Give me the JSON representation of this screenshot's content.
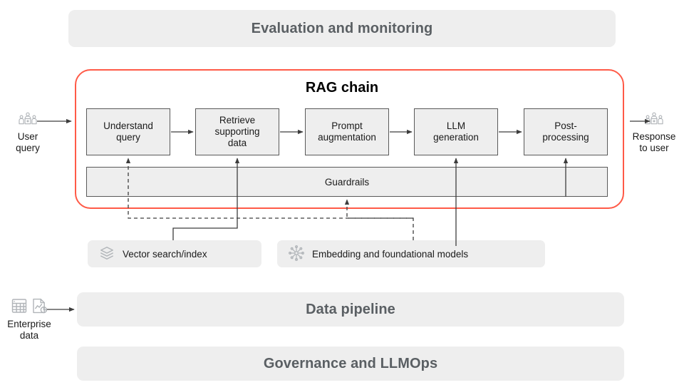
{
  "banners": [
    {
      "id": "evaluation",
      "label": "Evaluation and monitoring"
    },
    {
      "id": "data-pipeline",
      "label": "Data pipeline"
    },
    {
      "id": "governance",
      "label": "Governance and LLMOps"
    }
  ],
  "rag_chain": {
    "title": "RAG chain",
    "border_color": "#ff5a47",
    "steps": [
      {
        "id": "understand-query",
        "label": "Understand\nquery"
      },
      {
        "id": "retrieve-data",
        "label": "Retrieve\nsupporting\ndata"
      },
      {
        "id": "prompt-augmentation",
        "label": "Prompt\naugmentation"
      },
      {
        "id": "llm-generation",
        "label": "LLM\ngeneration"
      },
      {
        "id": "post-processing",
        "label": "Post-\nprocessing"
      }
    ],
    "guardrails": {
      "label": "Guardrails"
    }
  },
  "resources": [
    {
      "id": "vector-search",
      "label": "Vector search/index",
      "icon": "layers-stack-icon"
    },
    {
      "id": "embedding-models",
      "label": "Embedding and foundational models",
      "icon": "snowflake-network-icon"
    }
  ],
  "endpoints": [
    {
      "id": "user-query",
      "label": "User\nquery",
      "icons": [
        "user-group-icon"
      ]
    },
    {
      "id": "response-to-user",
      "label": "Response\nto user",
      "icons": [
        "user-group-icon"
      ]
    },
    {
      "id": "enterprise-data",
      "label": "Enterprise\ndata",
      "icons": [
        "table-grid-icon",
        "document-chart-icon"
      ]
    }
  ],
  "colors": {
    "accent": "#ff5a47",
    "banner_fill": "#eeeeee",
    "banner_text": "#5a5f63",
    "box_fill": "#eeeeee",
    "box_stroke": "#595959",
    "connector": "#3d3d3d",
    "icon": "#b0b4b8",
    "text": "#1a1a1a"
  }
}
